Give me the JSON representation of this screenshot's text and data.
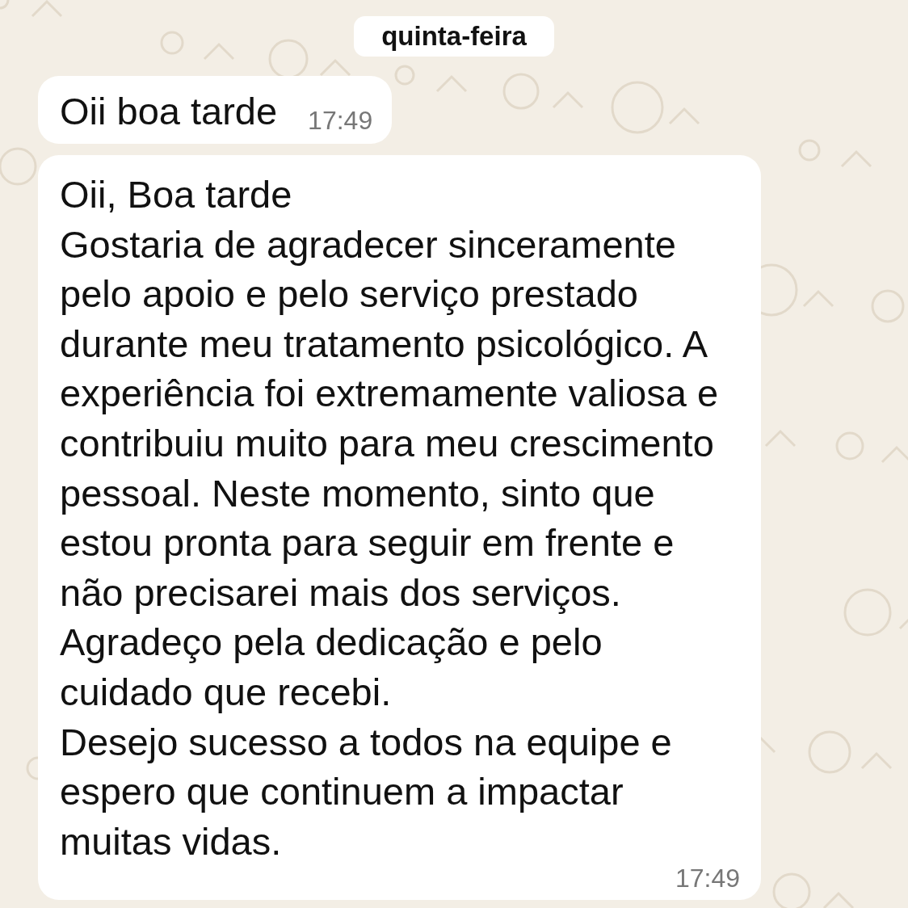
{
  "date_divider": "quinta-feira",
  "messages": [
    {
      "text": "Oii boa tarde",
      "time": "17:49"
    },
    {
      "text": "Oii, Boa tarde\nGostaria de agradecer sinceramente pelo apoio e pelo serviço prestado durante meu tratamento psicológico. A experiência foi extremamente valiosa e contribuiu muito para meu crescimento pessoal. Neste momento, sinto que estou pronta para seguir em frente e não precisarei mais dos serviços. Agradeço pela dedicação e pelo cuidado que recebi.\nDesejo sucesso a todos na equipe e espero que continuem a impactar muitas vidas.",
      "time": "17:49"
    }
  ]
}
